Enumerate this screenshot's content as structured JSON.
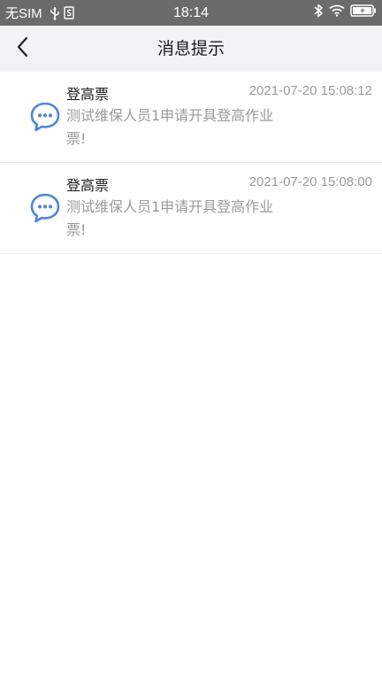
{
  "status_bar": {
    "carrier": "无SIM",
    "time": "18:14",
    "icons": [
      "usb-icon",
      "sim-icon",
      "bluetooth-icon",
      "wifi-icon",
      "battery-charging-icon"
    ]
  },
  "nav": {
    "title": "消息提示",
    "back_icon": "chevron-left-icon"
  },
  "messages": [
    {
      "title": "登高票",
      "time": "2021-07-20 15:08:12",
      "body": "测试维保人员1申请开具登高作业票!",
      "icon": "chat-bubble-icon"
    },
    {
      "title": "登高票",
      "time": "2021-07-20 15:08:00",
      "body": "测试维保人员1申请开具登高作业票!",
      "icon": "chat-bubble-icon"
    }
  ],
  "colors": {
    "status_bar_bg": "#6b6b6b",
    "nav_bg": "#f3f3f5",
    "icon_blue": "#4f86db",
    "secondary_text": "#9a9a9a"
  }
}
